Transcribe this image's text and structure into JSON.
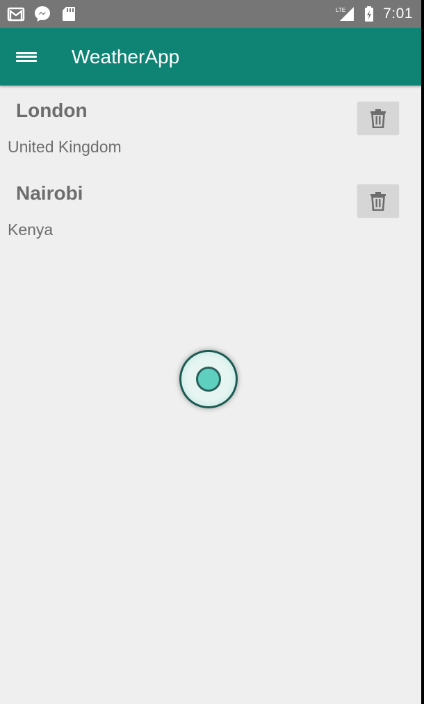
{
  "status_bar": {
    "left_icons": [
      "gmail-icon",
      "messenger-icon",
      "sd-card-icon"
    ],
    "network_label": "LTE",
    "time": "7:01",
    "background": "#767676"
  },
  "toolbar": {
    "title": "WeatherApp",
    "menu_icon": "hamburger-menu-icon",
    "background": "#0f8474"
  },
  "cities": [
    {
      "name": "London",
      "country": "United Kingdom",
      "delete_icon": "trash-icon"
    },
    {
      "name": "Nairobi",
      "country": "Kenya",
      "delete_icon": "trash-icon"
    }
  ],
  "colors": {
    "accent": "#0f8474",
    "background": "#efefef",
    "text_secondary": "#6d6d6d",
    "delete_button": "#d6d6d6"
  }
}
